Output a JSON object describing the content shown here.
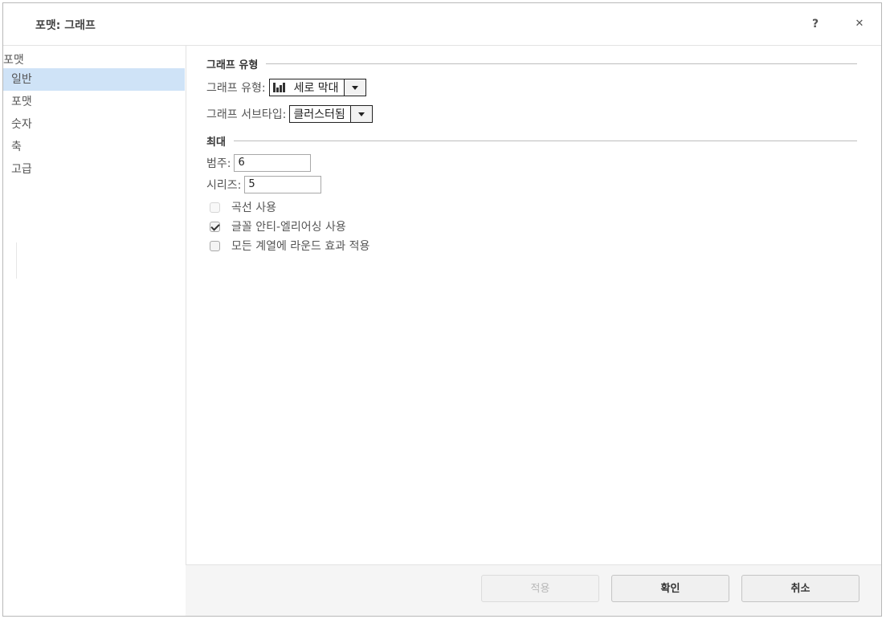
{
  "dialog": {
    "title": "포맷: 그래프",
    "help_label": "?",
    "close_label": "✕"
  },
  "sidebar": {
    "header": "포맷",
    "items": [
      {
        "label": "일반",
        "selected": true
      },
      {
        "label": "포맷",
        "selected": false
      },
      {
        "label": "숫자",
        "selected": false
      },
      {
        "label": "축",
        "selected": false
      },
      {
        "label": "고급",
        "selected": false
      }
    ]
  },
  "graph_type_section": {
    "title": "그래프 유형",
    "type_label": "그래프 유형:",
    "type_value": "세로 막대",
    "type_icon": "vertical-bar-chart-icon",
    "subtype_label": "그래프 서브타입:",
    "subtype_value": "클러스터됨"
  },
  "max_section": {
    "title": "최대",
    "legend_label": "범주:",
    "legend_value": "6",
    "series_label": "시리즈:",
    "series_value": "5"
  },
  "options": [
    {
      "label": "곡선 사용",
      "checked": false,
      "enabled": false
    },
    {
      "label": "글꼴 안티-엘리어싱 사용",
      "checked": true,
      "enabled": true
    },
    {
      "label": "모든 계열에 라운드 효과 적용",
      "checked": false,
      "enabled": true
    }
  ],
  "footer": {
    "apply_label": "적용",
    "ok_label": "확인",
    "cancel_label": "취소"
  }
}
